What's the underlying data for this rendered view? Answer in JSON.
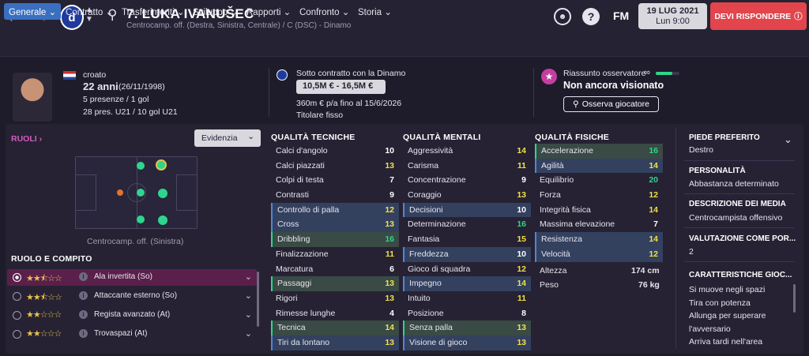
{
  "header": {
    "player_title": "7. LUKA IVANUŠEC",
    "player_subtitle": "Centrocamp. off. (Destra, Sinistra, Centrale) / C (DSC) - Dinamo",
    "fm_label": "FM",
    "date_line1": "19 LUG 2021",
    "date_line2": "Lun 9:00",
    "respond_label": "DEVI RISPONDERE"
  },
  "tabs": [
    {
      "label": "Generale"
    },
    {
      "label": "Contratto"
    },
    {
      "label": "Trasferimenti"
    },
    {
      "label": "Sviluppo"
    },
    {
      "label": "Rapporti"
    },
    {
      "label": "Confronto"
    },
    {
      "label": "Storia"
    }
  ],
  "info": {
    "nationality": "croato",
    "age": "22 anni",
    "birth": "(26/11/1998)",
    "apps": "5 presenze / 1 gol",
    "u21": "28 pres. U21 / 10 gol U21",
    "contract_header": "Sotto contratto con la Dinamo",
    "value": "10,5M € - 16,5M €",
    "wage": "360m € p/a fino al 15/6/2026",
    "status": "Titolare fisso",
    "scout_header": "Riassunto osservatore",
    "scout_status": "Non ancora visionato",
    "scout_button": "Osserva giocatore",
    "scout_progress": 0.7
  },
  "positions": {
    "title": "RUOLI",
    "highlight_label": "Evidenzia",
    "caption": "Centrocamp. off. (Sinistra)"
  },
  "roles": {
    "title": "RUOLO E COMPITO",
    "items": [
      {
        "stars": "★★★",
        "name": "Ala invertita (So)",
        "rating": 2.5
      },
      {
        "stars": "★★★",
        "name": "Attaccante esterno (So)",
        "rating": 2.5
      },
      {
        "stars": "★★",
        "name": "Regista avanzato (At)",
        "rating": 2
      },
      {
        "stars": "★★",
        "name": "Trovaspazi (At)",
        "rating": 2
      }
    ]
  },
  "technical": {
    "title": "QUALITÀ TECNICHE",
    "items": [
      {
        "name": "Calci d'angolo",
        "value": 10,
        "hl": ""
      },
      {
        "name": "Calci piazzati",
        "value": 13,
        "hl": ""
      },
      {
        "name": "Colpi di testa",
        "value": 7,
        "hl": ""
      },
      {
        "name": "Contrasti",
        "value": 9,
        "hl": ""
      },
      {
        "name": "Controllo di palla",
        "value": 12,
        "hl": "b"
      },
      {
        "name": "Cross",
        "value": 13,
        "hl": "b"
      },
      {
        "name": "Dribbling",
        "value": 16,
        "hl": "g"
      },
      {
        "name": "Finalizzazione",
        "value": 11,
        "hl": ""
      },
      {
        "name": "Marcatura",
        "value": 6,
        "hl": ""
      },
      {
        "name": "Passaggi",
        "value": 13,
        "hl": "g"
      },
      {
        "name": "Rigori",
        "value": 13,
        "hl": ""
      },
      {
        "name": "Rimesse lunghe",
        "value": 4,
        "hl": ""
      },
      {
        "name": "Tecnica",
        "value": 14,
        "hl": "g"
      },
      {
        "name": "Tiri da lontano",
        "value": 13,
        "hl": "b"
      }
    ]
  },
  "mental": {
    "title": "QUALITÀ MENTALI",
    "items": [
      {
        "name": "Aggressività",
        "value": 14,
        "hl": ""
      },
      {
        "name": "Carisma",
        "value": 11,
        "hl": ""
      },
      {
        "name": "Concentrazione",
        "value": 9,
        "hl": ""
      },
      {
        "name": "Coraggio",
        "value": 13,
        "hl": ""
      },
      {
        "name": "Decisioni",
        "value": 10,
        "hl": "b"
      },
      {
        "name": "Determinazione",
        "value": 16,
        "hl": ""
      },
      {
        "name": "Fantasia",
        "value": 15,
        "hl": ""
      },
      {
        "name": "Freddezza",
        "value": 10,
        "hl": "b"
      },
      {
        "name": "Gioco di squadra",
        "value": 12,
        "hl": ""
      },
      {
        "name": "Impegno",
        "value": 14,
        "hl": "b"
      },
      {
        "name": "Intuito",
        "value": 11,
        "hl": ""
      },
      {
        "name": "Posizione",
        "value": 8,
        "hl": ""
      },
      {
        "name": "Senza palla",
        "value": 13,
        "hl": "g"
      },
      {
        "name": "Visione di gioco",
        "value": 13,
        "hl": "b"
      }
    ]
  },
  "physical": {
    "title": "QUALITÀ FISICHE",
    "items": [
      {
        "name": "Accelerazione",
        "value": 16,
        "hl": "g"
      },
      {
        "name": "Agilità",
        "value": 14,
        "hl": "b"
      },
      {
        "name": "Equilibrio",
        "value": 20,
        "hl": ""
      },
      {
        "name": "Forza",
        "value": 12,
        "hl": ""
      },
      {
        "name": "Integrità fisica",
        "value": 14,
        "hl": ""
      },
      {
        "name": "Massima elevazione",
        "value": 7,
        "hl": ""
      },
      {
        "name": "Resistenza",
        "value": 14,
        "hl": "b"
      },
      {
        "name": "Velocità",
        "value": 12,
        "hl": "b"
      }
    ],
    "height_label": "Altezza",
    "height": "174 cm",
    "weight_label": "Peso",
    "weight": "76 kg"
  },
  "sidebar": {
    "foot_label": "PIEDE PREFERITO",
    "foot": "Destro",
    "personality_label": "PERSONALITÀ",
    "personality": "Abbastanza determinato",
    "media_label": "DESCRIZIONE DEI MEDIA",
    "media": "Centrocampista offensivo",
    "rating_label": "VALUTAZIONE COME POR...",
    "rating": "2",
    "traits_label": "CARATTERISTICHE GIOC...",
    "traits": [
      "Si muove negli spazi",
      "Tira con potenza",
      "Allunga per superare",
      "l'avversario",
      "Arriva tardi nell'area"
    ]
  },
  "colors": {
    "good": "#2ed58d",
    "decent": "#f0e14a",
    "neutral": "#ffffff",
    "accent": "#3a6fc0",
    "alert": "#e2454c"
  }
}
